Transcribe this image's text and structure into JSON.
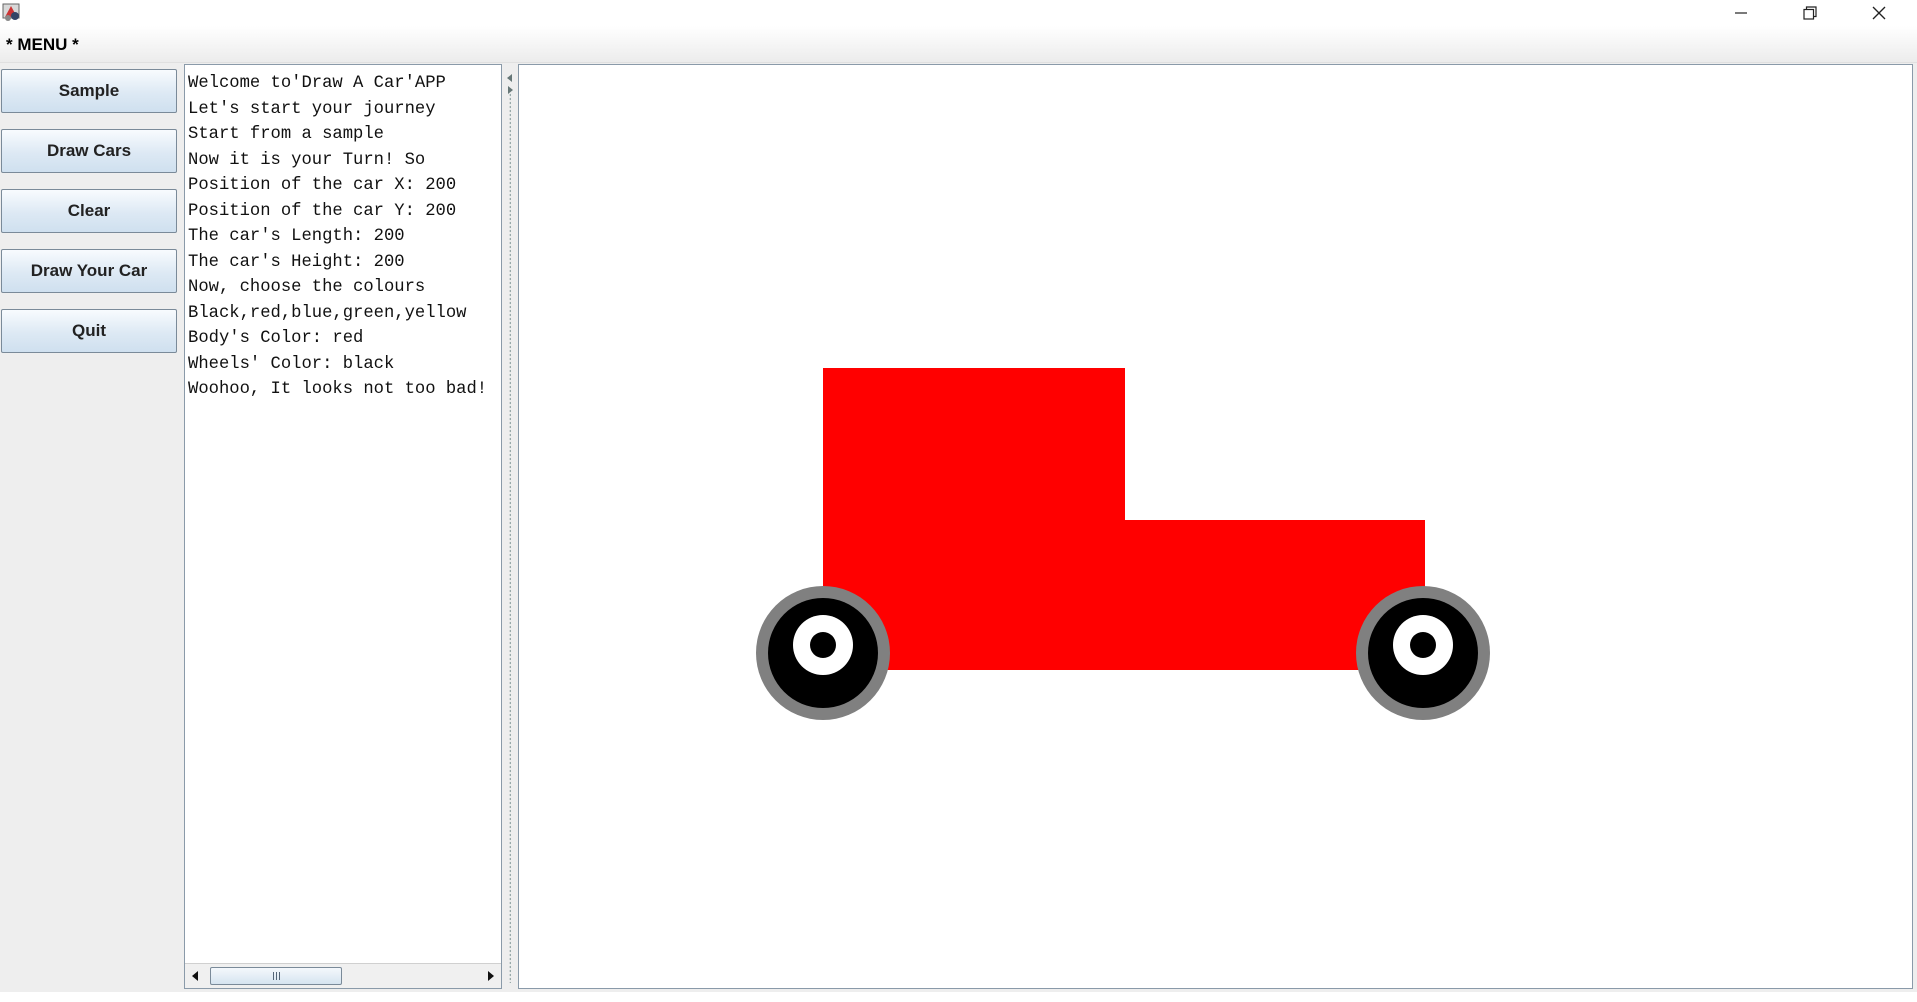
{
  "window": {
    "controls": {
      "minimize_icon": "minimize-icon",
      "maximize_icon": "restore-icon",
      "close_icon": "close-icon"
    }
  },
  "menu": {
    "title": "* MENU *"
  },
  "buttons": {
    "sample": "Sample",
    "draw_cars": "Draw Cars",
    "clear": "Clear",
    "draw_your_car": "Draw Your Car",
    "quit": "Quit"
  },
  "console": {
    "lines": [
      "Welcome to'Draw A Car'APP",
      "Let's start your journey",
      "Start from a sample",
      "Now it is your Turn! So",
      "Position of the car X: 200",
      "Position of the car Y: 200",
      "The car's Length: 200",
      "The car's Height: 200",
      "Now, choose the colours",
      "Black,red,blue,green,yellow",
      "Body's Color: red",
      "Wheels' Color: black",
      "Woohoo, It looks not too bad!"
    ]
  },
  "car": {
    "body_color": "#ff0000",
    "tire_color": "#000000",
    "rim_color": "#808080",
    "hub_color": "#ffffff"
  },
  "colors": {
    "button_border": "#7a8a99",
    "panel_bg": "#eeeeee",
    "canvas_bg": "#ffffff"
  }
}
